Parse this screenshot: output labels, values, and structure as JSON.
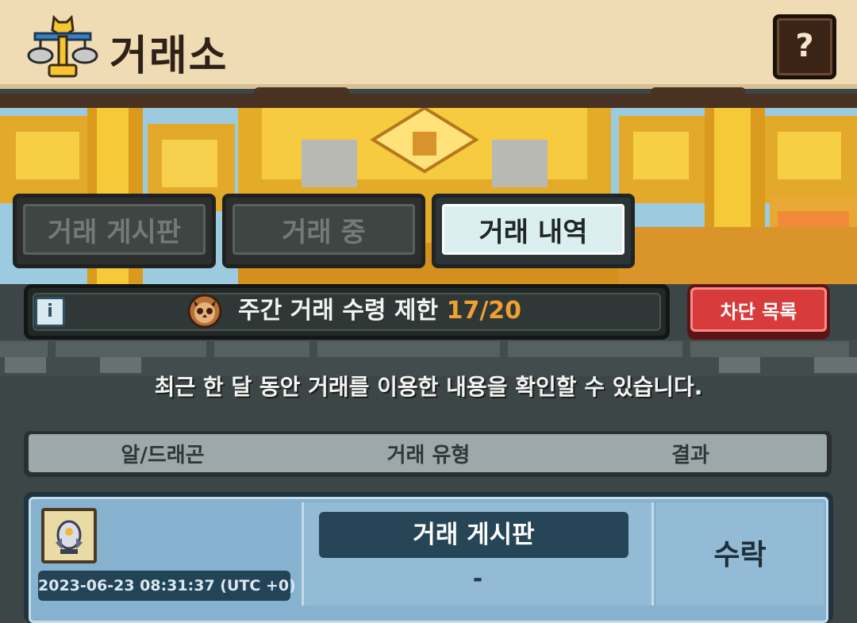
{
  "header": {
    "title": "거래소",
    "help_label": "?",
    "logo_icon": "golden-scales-icon"
  },
  "tabs": [
    {
      "label": "거래 게시판",
      "active": false
    },
    {
      "label": "거래 중",
      "active": false
    },
    {
      "label": "거래 내역",
      "active": true
    }
  ],
  "info_bar": {
    "info_icon_label": "i",
    "owl_icon": "owl-coin-icon",
    "limit_label": "주간 거래 수령 제한",
    "limit_count": "17/20"
  },
  "block_list_label": "차단 목록",
  "notice": "최근 한 달 동안 거래를 이용한 내용을 확인할 수 있습니다.",
  "table": {
    "columns": [
      "알/드래곤",
      "거래 유형",
      "결과"
    ],
    "rows": [
      {
        "thumbnail_icon": "dragon-egg-icon",
        "date": "2023-06-23 08:31:37 (UTC +0)",
        "type": "거래 게시판",
        "detail": "-",
        "result": "수락"
      }
    ]
  },
  "colors": {
    "header_bg": "#efdcb5",
    "active_tab": "#dbeef0",
    "inactive_tab": "#3e4542",
    "accent_orange": "#f0a032",
    "block_button": "#d83b3b",
    "row_bg": "#86b2cf"
  }
}
